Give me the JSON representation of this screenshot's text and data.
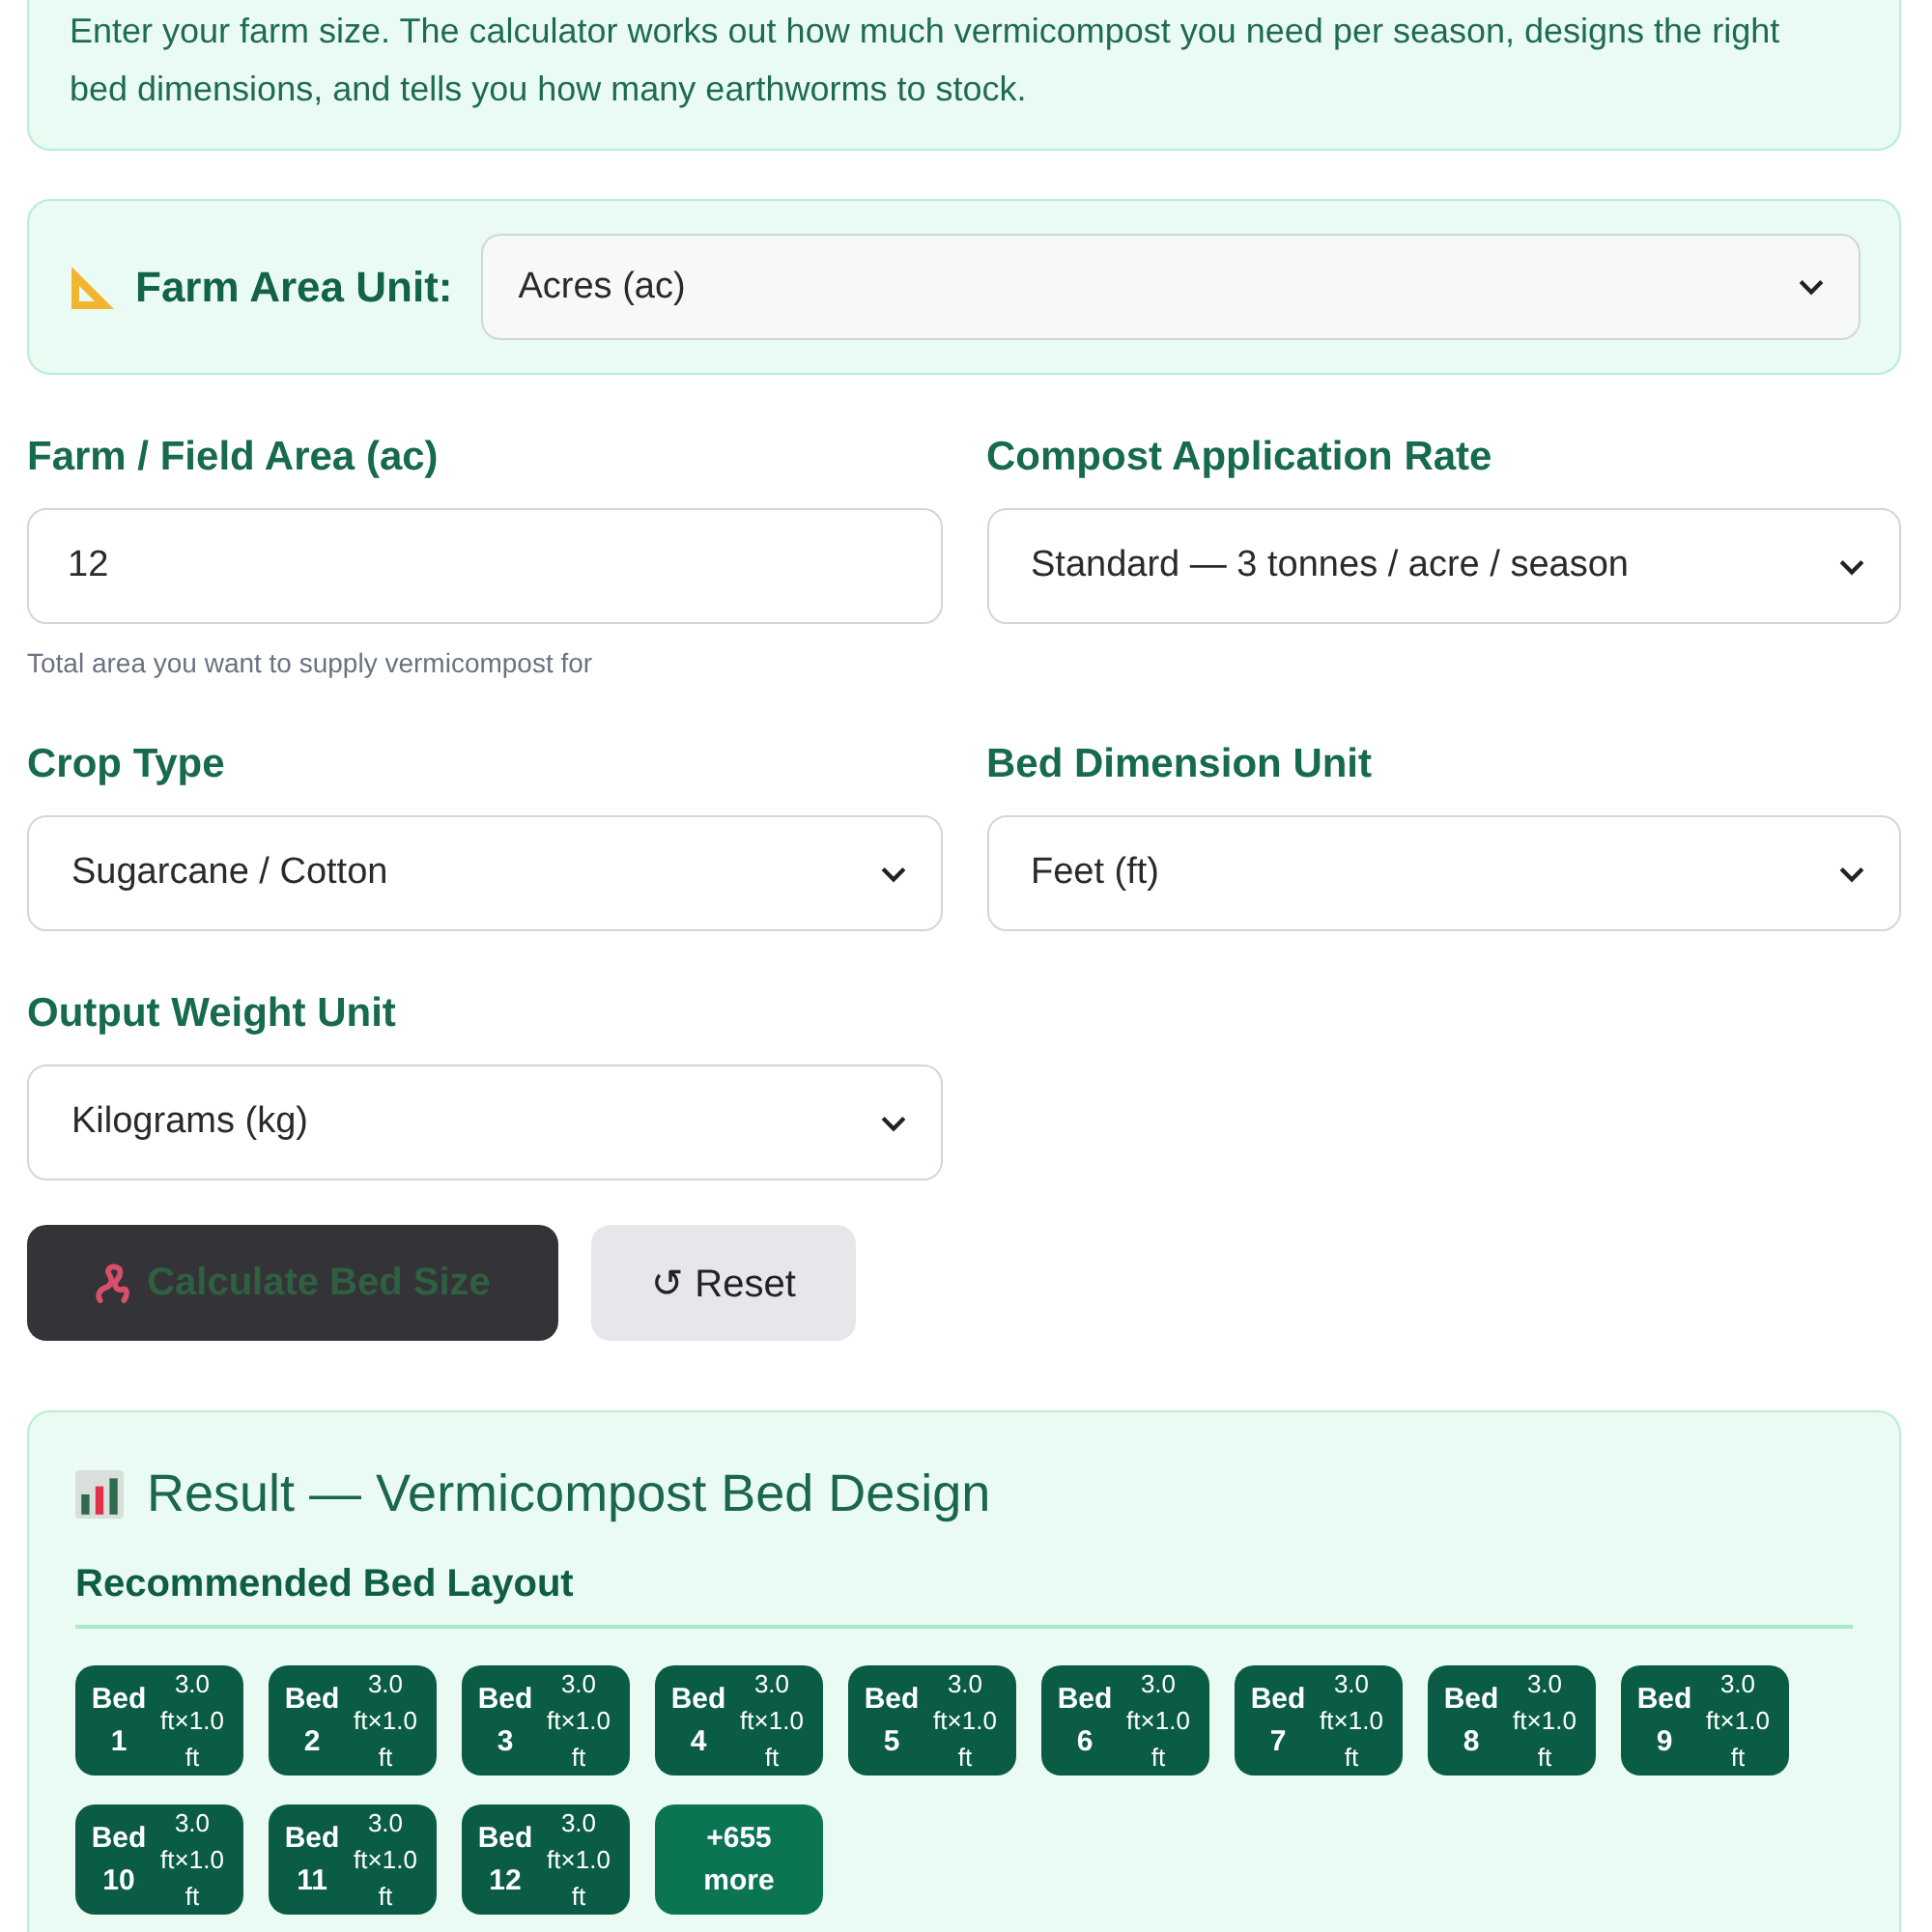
{
  "intro": {
    "text": "Enter your farm size. The calculator works out how much vermicompost you need per season, designs the right bed dimensions, and tells you how many earthworms to stock."
  },
  "unit_selector": {
    "label": "Farm Area Unit:",
    "value": "Acres (ac)"
  },
  "fields": [
    {
      "kind": "input",
      "label": "Farm / Field Area (ac)",
      "value": "12",
      "hint": "Total area you want to supply vermicompost for"
    },
    {
      "kind": "select",
      "label": "Compost Application Rate",
      "value": "Standard — 3 tonnes / acre / season"
    },
    {
      "kind": "select",
      "label": "Crop Type",
      "value": "Sugarcane / Cotton"
    },
    {
      "kind": "select",
      "label": "Bed Dimension Unit",
      "value": "Feet (ft)"
    },
    {
      "kind": "select",
      "label": "Output Weight Unit",
      "value": "Kilograms (kg)"
    }
  ],
  "buttons": [
    {
      "kind": "primary",
      "label": "Calculate Bed Size"
    },
    {
      "kind": "secondary",
      "label": "↺ Reset"
    }
  ],
  "result": {
    "title": "Result — Vermicompost Bed Design",
    "layout_heading": "Recommended Bed Layout",
    "beds": [
      {
        "label": "Bed 1",
        "size": "3.0 ft×1.0 ft"
      },
      {
        "label": "Bed 2",
        "size": "3.0 ft×1.0 ft"
      },
      {
        "label": "Bed 3",
        "size": "3.0 ft×1.0 ft"
      },
      {
        "label": "Bed 4",
        "size": "3.0 ft×1.0 ft"
      },
      {
        "label": "Bed 5",
        "size": "3.0 ft×1.0 ft"
      },
      {
        "label": "Bed 6",
        "size": "3.0 ft×1.0 ft"
      },
      {
        "label": "Bed 7",
        "size": "3.0 ft×1.0 ft"
      },
      {
        "label": "Bed 8",
        "size": "3.0 ft×1.0 ft"
      },
      {
        "label": "Bed 9",
        "size": "3.0 ft×1.0 ft"
      },
      {
        "label": "Bed 10",
        "size": "3.0 ft×1.0 ft"
      },
      {
        "label": "Bed 11",
        "size": "3.0 ft×1.0 ft"
      },
      {
        "label": "Bed 12",
        "size": "3.0 ft×1.0 ft"
      }
    ],
    "more": "+655 more"
  }
}
